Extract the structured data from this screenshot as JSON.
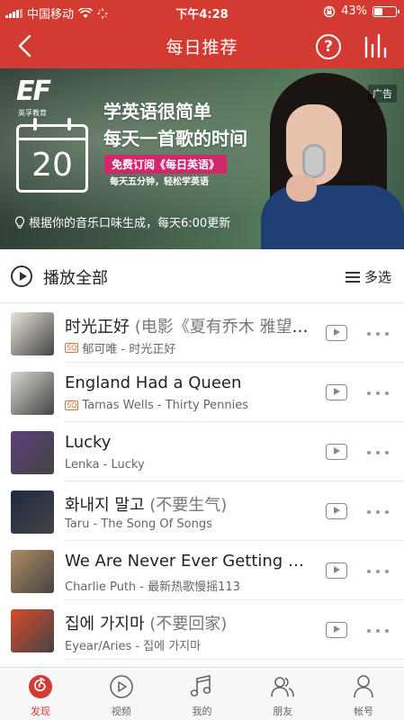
{
  "status_bar": {
    "carrier": "中国移动",
    "time": "下午4:28",
    "battery_percent": "43%",
    "battery_level": 0.43
  },
  "navbar": {
    "title": "每日推荐",
    "help_label": "?"
  },
  "banner": {
    "ad_label": "广告",
    "logo_text": "EF",
    "logo_sub": "英孚教育",
    "calendar_day": "20",
    "headline_1": "学英语很简单",
    "headline_2": "每天一首歌的时间",
    "promo_tag": "免费订阅《每日英语》",
    "promo_sub": "每天五分钟，轻松学英语",
    "hint": "根据你的音乐口味生成，每天6:00更新"
  },
  "play_all": {
    "label": "播放全部",
    "multi_select": "多选"
  },
  "songs": [
    {
      "title": "时光正好",
      "alias": " (电影《夏有乔木 雅望天堂》插曲)",
      "sq": true,
      "meta": "郁可唯 - 时光正好",
      "cover_color": "#e9e4da"
    },
    {
      "title": "England Had a Queen",
      "alias": "",
      "sq": true,
      "meta": "Tamas Wells - Thirty Pennies",
      "cover_color": "#d9d6cf"
    },
    {
      "title": "Lucky",
      "alias": "",
      "sq": false,
      "meta": "Lenka - Lucky",
      "cover_color": "#5a3f7a"
    },
    {
      "title": "화내지 말고",
      "alias": " (不要生气)",
      "sq": false,
      "meta": "Taru - The Song Of Songs",
      "cover_color": "#1d2a44"
    },
    {
      "title": "We Are Never Ever Getting Back Together",
      "alias": "",
      "sq": false,
      "meta": "Charlie Puth - 最新热歌慢摇113",
      "cover_color": "#b08a62"
    },
    {
      "title": "집에 가지마",
      "alias": " (不要回家)",
      "sq": false,
      "meta": "Eyear/Aries - 집에 가지마",
      "cover_color": "#d84a2e"
    }
  ],
  "sq_label": "SQ",
  "tabs": [
    {
      "label": "发现",
      "icon": "discover-icon",
      "active": true
    },
    {
      "label": "视频",
      "icon": "video-icon",
      "active": false
    },
    {
      "label": "我的",
      "icon": "music-note-icon",
      "active": false
    },
    {
      "label": "朋友",
      "icon": "friends-icon",
      "active": false
    },
    {
      "label": "帐号",
      "icon": "account-icon",
      "active": false
    }
  ],
  "colors": {
    "brand_red": "#d33a31",
    "sq_orange": "#e76b34",
    "promo_pink": "#d3276c"
  }
}
